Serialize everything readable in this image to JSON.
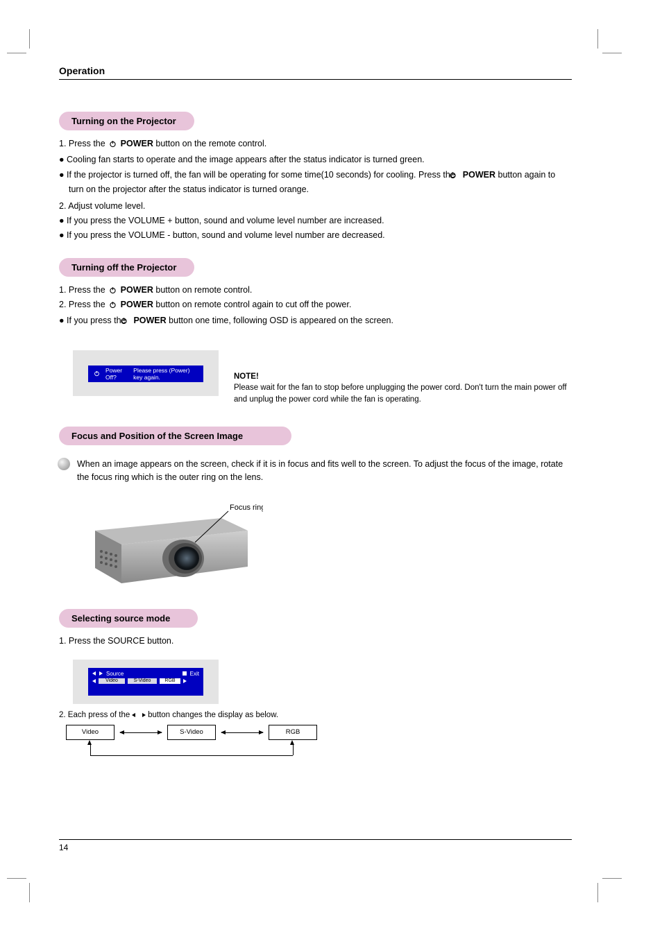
{
  "header": {
    "title": "Operation"
  },
  "sections": {
    "s1": {
      "heading": "Turning on the Projector",
      "p1a": "1. Press the ",
      "p1b": "POWER",
      "p1c": "  button on the remote control.",
      "bullets": {
        "b1a": "Cooling fan starts to operate and the image appears after the status indicator is turned green.",
        "b2a": "If the projector is turned off, the fan will be operating for some time(10 seconds) for cooling. Press the ",
        "b2b": "POWER",
        "b2c": " button again to turn on the projector after the status indicator is turned orange.",
        "b3": "Adjust volume level.",
        "b4": "If you press the VOLUME + button, sound and volume level number are increased.",
        "b5": "If you press the VOLUME - button, sound and volume level number are decreased."
      },
      "n2": "2.  "
    },
    "s2": {
      "heading": "Turning off the Projector",
      "line1a": "1. Press the ",
      "line1b": "POWER",
      "line1c": " button on remote control.",
      "line2a": "2. Press the ",
      "line2b": "POWER",
      "line2c": " button on remote control again to cut off the power.",
      "line3a": "If you press the ",
      "line3b": "POWER",
      "line3c": " button one time, following OSD is appeared on the screen.",
      "osd": {
        "label": "Power Off?",
        "right": "Please press (Power) key again."
      },
      "note_title": "NOTE!",
      "note_body": "Please wait for the fan to stop before unplugging the power cord. Don't turn the main power off and unplug the power cord while the fan is operating."
    },
    "s3": {
      "heading": "Focus and Position of the Screen Image",
      "body": "When an image appears on the screen, check if it is in focus and fits well to the screen. To adjust the focus of the image, rotate the focus ring which is the outer ring on the lens.",
      "callout": "Focus ring"
    },
    "s4": {
      "heading": "Selecting source mode",
      "step1": "1. Press the SOURCE button.",
      "osd": {
        "row1_label": "Source",
        "row1_right": "Exit",
        "nodes": {
          "a": "Video",
          "b": "S-Video",
          "c": "RGB"
        }
      },
      "step2a": "2. Each press of the  ",
      "step2b": "  button changes the display as below.",
      "cycle": {
        "a": "Video",
        "b": "S-Video",
        "c": "RGB"
      }
    }
  },
  "footer": {
    "page": "14"
  }
}
